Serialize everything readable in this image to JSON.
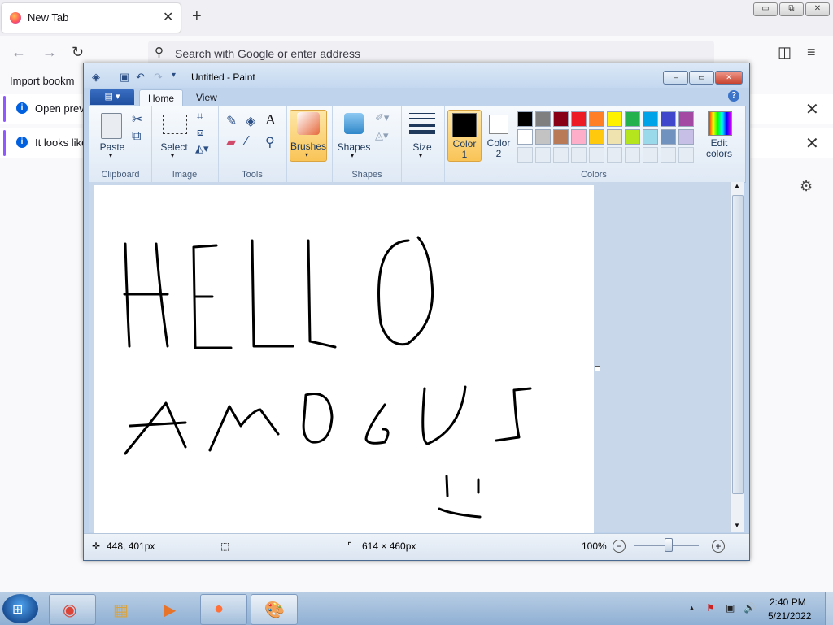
{
  "browser": {
    "tab_title": "New Tab",
    "tab_close": "✕",
    "new_tab": "+",
    "window_controls": [
      "▭",
      "⧉",
      "✕"
    ],
    "search_placeholder": "Search with Google or enter address",
    "bookmark_import": "Import bookm",
    "notifications": [
      {
        "text": "Open previ",
        "icon": "i",
        "close": "✕"
      },
      {
        "text": "It looks like",
        "icon": "i",
        "close": "✕"
      }
    ],
    "icons": {
      "back": "←",
      "forward": "→",
      "reload": "↻",
      "pocket": "◫",
      "menu": "≡",
      "settings": "⚙",
      "search": "⚲"
    }
  },
  "paint": {
    "title": "Untitled - Paint",
    "window_controls": [
      "‒",
      "▭",
      "✕"
    ],
    "tabs": {
      "file": "▤ ▾",
      "home": "Home",
      "view": "View"
    },
    "help": "?",
    "groups": {
      "clipboard": {
        "label": "Clipboard",
        "paste": "Paste"
      },
      "image": {
        "label": "Image",
        "select": "Select"
      },
      "tools": {
        "label": "Tools"
      },
      "brushes": {
        "label": "Brushes"
      },
      "shapes": {
        "label": "Shapes",
        "shapes": "Shapes"
      },
      "size": {
        "label": "Size"
      },
      "colors": {
        "label": "Colors",
        "color1": "Color\n1",
        "color2": "Color\n2",
        "edit": "Edit\ncolors",
        "color1_value": "#000000",
        "color2_value": "#ffffff",
        "palette_row1": [
          "#000000",
          "#7f7f7f",
          "#880015",
          "#ed1c24",
          "#ff7f27",
          "#fff200",
          "#22b14c",
          "#00a2e8",
          "#3f48cc",
          "#a349a4"
        ],
        "palette_row2": [
          "#ffffff",
          "#c3c3c3",
          "#b97a57",
          "#ffaec9",
          "#ffc90e",
          "#efe4b0",
          "#b5e61d",
          "#99d9ea",
          "#7092be",
          "#c8bfe7"
        ]
      }
    },
    "status": {
      "cursor_pos": "448, 401px",
      "canvas_size": "614 × 460px",
      "zoom": "100%",
      "zoom_level": 1.0,
      "minus": "−",
      "plus": "+"
    },
    "canvas_text_line1": "HELLO",
    "canvas_text_line2": "AMOGUS"
  },
  "taskbar": {
    "time": "2:40 PM",
    "date": "5/21/2022",
    "start": "⊞",
    "apps": [
      {
        "name": "chrome",
        "glyph": "◉"
      },
      {
        "name": "explorer",
        "glyph": "▦"
      },
      {
        "name": "media",
        "glyph": "▶"
      },
      {
        "name": "firefox",
        "glyph": "●"
      },
      {
        "name": "paint",
        "glyph": "🎨"
      }
    ],
    "tray": [
      "▲",
      "⚑",
      "▣",
      "🔊"
    ]
  }
}
